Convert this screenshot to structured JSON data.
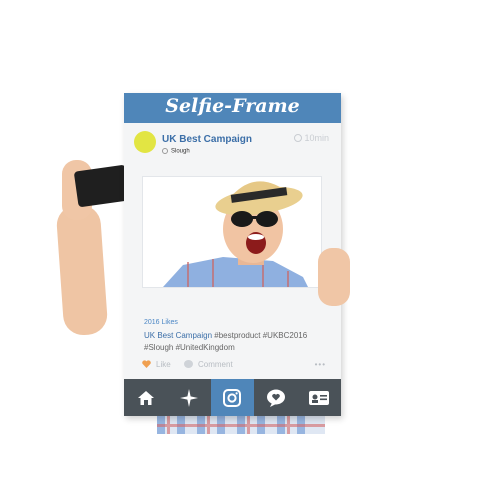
{
  "frame": {
    "title": "Selfie-Frame",
    "profile_name": "UK Best Campaign",
    "location": "Slough",
    "time": "10min",
    "likes": "2016 Likes",
    "caption_account": "UK Best Campaign",
    "caption_tags_line1": " #bestproduct #UKBC2016",
    "caption_tags_line2": "#Slough #UnitedKingdom",
    "like_label": "Like",
    "comment_label": "Comment",
    "more_label": "•••"
  },
  "tabs": [
    {
      "icon": "home-icon"
    },
    {
      "icon": "explore-icon"
    },
    {
      "icon": "camera-icon"
    },
    {
      "icon": "activity-icon"
    },
    {
      "icon": "profile-icon"
    }
  ],
  "colors": {
    "frame_blue": "#4f86b9",
    "tab_dark": "#4a5258",
    "link_blue": "#3c6fa8",
    "avatar_yellow": "#e2e543",
    "heart_orange": "#f0a050"
  }
}
